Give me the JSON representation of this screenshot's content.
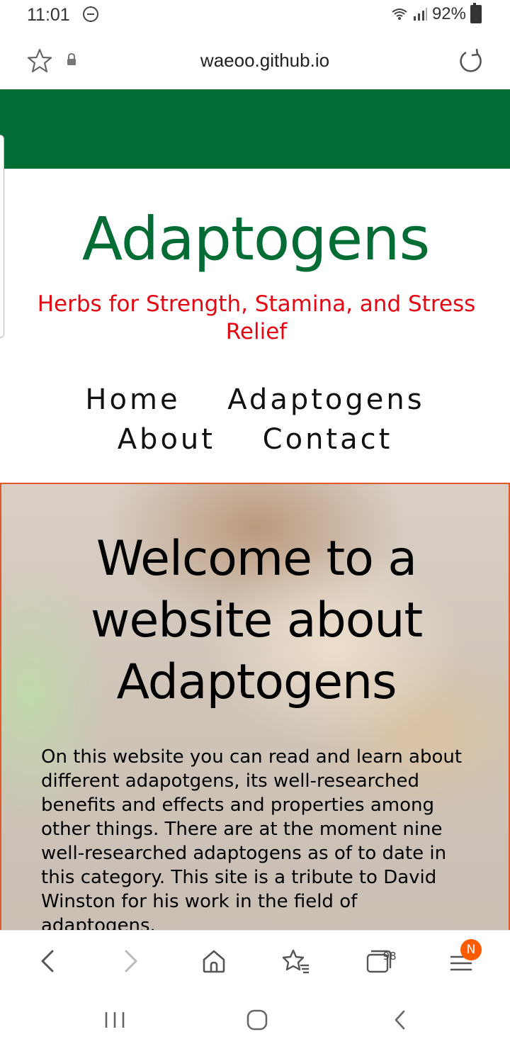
{
  "status_bar": {
    "time": "11:01",
    "battery": "92%",
    "icons": [
      "do-not-disturb-icon",
      "wifi-icon",
      "signal-icon",
      "battery-icon"
    ]
  },
  "address_bar": {
    "url": "waeoo.github.io",
    "icons": [
      "bookmark-star-icon",
      "lock-icon",
      "reload-icon"
    ]
  },
  "site": {
    "title": "Adaptogens",
    "subtitle": "Herbs for Strength, Stamina, and Stress Relief",
    "nav": {
      "row1": [
        "Home",
        "Adaptogens"
      ],
      "row2": [
        "About",
        "Contact"
      ]
    }
  },
  "hero": {
    "heading_lines": [
      "Welcome to a",
      "website about",
      "Adaptogens"
    ],
    "text": "On this website you can read and learn about different adapotgens, its well-researched benefits and effects and properties among other things. There are at the moment nine well-researched adaptogens as of to date in this category. This site is a tribute to David Winston for his work in the field of adaptogens."
  },
  "browser_toolbar": {
    "tabs_count": "98",
    "menu_badge": "N",
    "icons": [
      "back-icon",
      "forward-icon",
      "home-icon",
      "bookmarks-icon",
      "tabs-icon",
      "menu-icon"
    ]
  },
  "colors": {
    "brand_green": "#016d35",
    "subtitle_red": "#e30613",
    "hero_border": "#e1582b",
    "badge_orange": "#ff5b00"
  }
}
